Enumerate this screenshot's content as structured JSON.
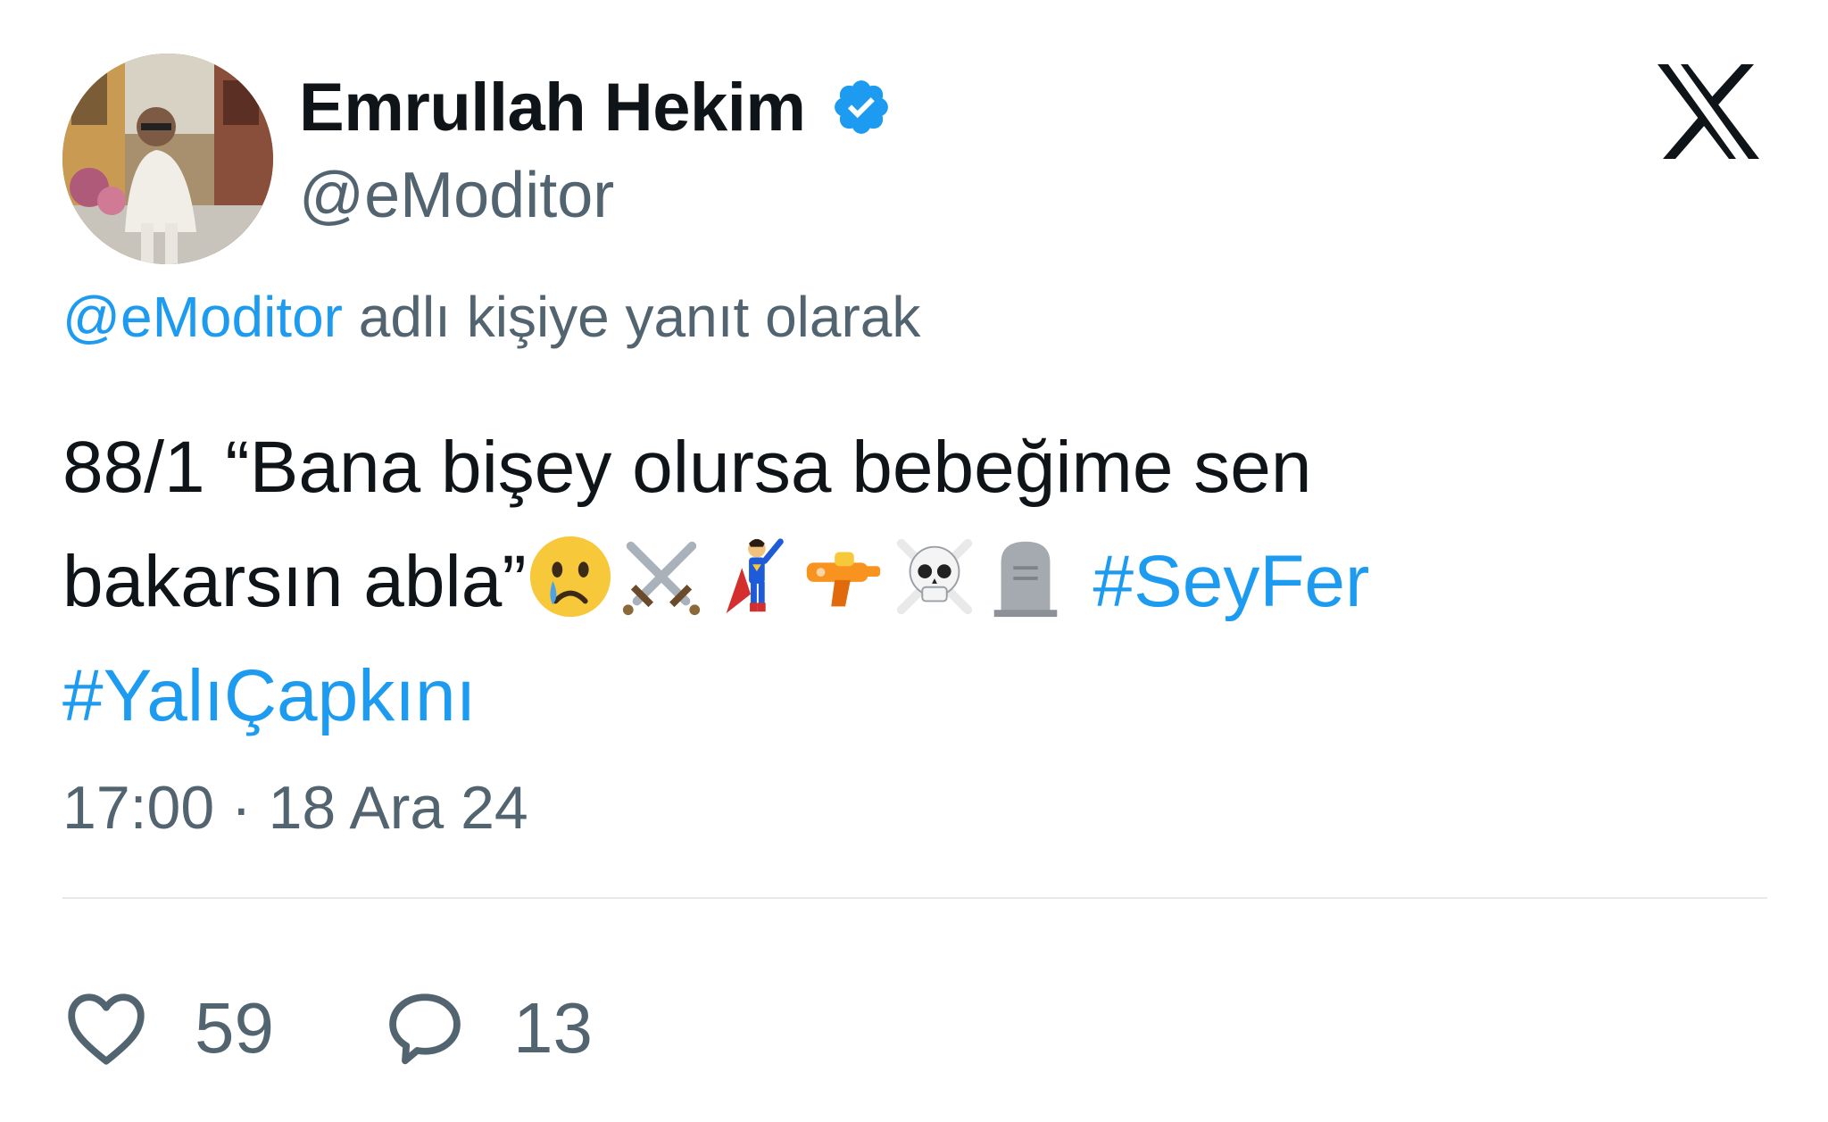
{
  "author": {
    "display_name": "Emrullah Hekim",
    "handle": "@eModitor",
    "verified": true
  },
  "reply_context": {
    "mention": "@eModitor",
    "text": " adlı kişiye yanıt olarak"
  },
  "tweet": {
    "line1": "88/1 “Bana bişey olursa bebeğime sen",
    "line2_text": "bakarsın abla”",
    "emojis": [
      "crying-face",
      "crossed-swords",
      "superhero",
      "water-pistol",
      "skull-and-crossbones",
      "headstone"
    ],
    "hashtag1": "#SeyFer",
    "hashtag2": "#YalıÇapkını"
  },
  "timestamp": "17:00 · 18 Ara 24",
  "stats": {
    "likes": "59",
    "replies": "13"
  },
  "icons": {
    "like": "heart-icon",
    "reply": "speech-bubble-icon",
    "platform": "x-logo-icon",
    "verified": "verified-badge-icon"
  },
  "colors": {
    "link": "#1d9bf0",
    "secondary": "#536471",
    "primary": "#0f1419",
    "badge": "#1d9bf0"
  }
}
